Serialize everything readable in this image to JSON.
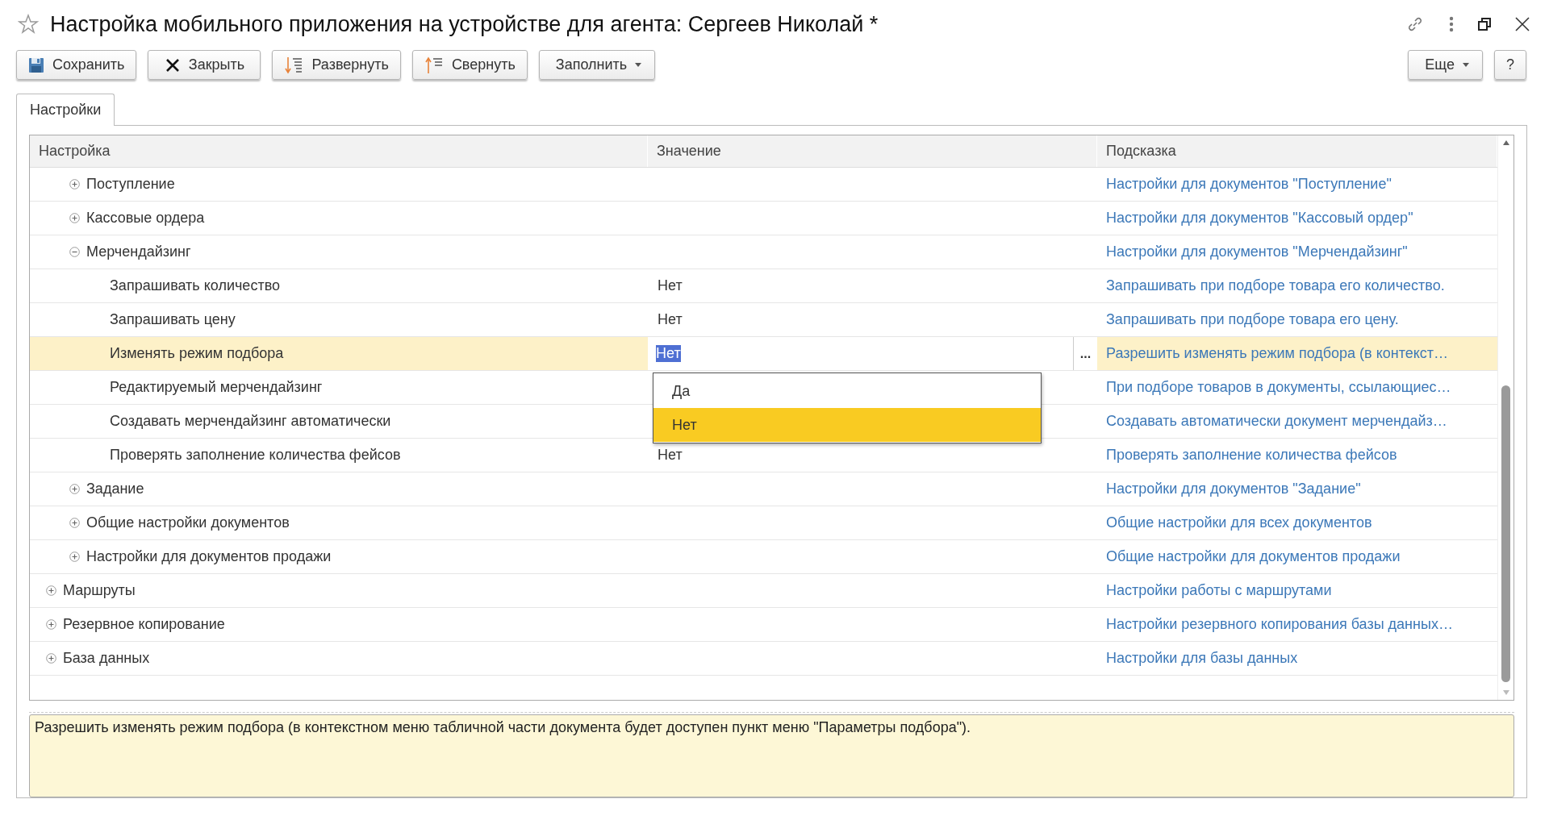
{
  "window": {
    "title": "Настройка мобильного приложения на устройстве для агента: Сергеев Николай *",
    "favorite": false
  },
  "toolbar": {
    "left": [
      {
        "label": "Сохранить",
        "kind": "save"
      },
      {
        "label": "Закрыть",
        "kind": "close"
      },
      {
        "label": "Развернуть",
        "kind": "expand"
      },
      {
        "label": "Свернуть",
        "kind": "collapse"
      },
      {
        "label": "Заполнить",
        "kind": "menu"
      }
    ],
    "right": [
      {
        "label": "Еще",
        "kind": "menu"
      },
      {
        "label": "?",
        "kind": "plain"
      }
    ]
  },
  "tabs": [
    {
      "label": "Настройки",
      "selected": true
    }
  ],
  "tree": {
    "columns": [
      "Настройка",
      "Значение",
      "Подсказка"
    ],
    "rows": [
      {
        "kind": "hidden_parent",
        "children": [
          {
            "kind": "group",
            "label": "Поступление",
            "expanded": false,
            "selected": false,
            "hint": "Настройки для документов \"Поступление\""
          },
          {
            "kind": "group",
            "label": "Кассовые ордера",
            "expanded": false,
            "selected": false,
            "hint": "Настройки для документов \"Кассовый ордер\""
          },
          {
            "kind": "group",
            "label": "Мерчендайзинг",
            "expanded": true,
            "selected": false,
            "hint": "Настройки для документов \"Мерчендайзинг\"",
            "children": [
              {
                "kind": "setting",
                "label": "Запрашивать количество",
                "value": "Нет",
                "selected": false,
                "hint": "Запрашивать при подборе товара его количество."
              },
              {
                "kind": "setting",
                "label": "Запрашивать цену",
                "value": "Нет",
                "selected": false,
                "hint": "Запрашивать при подборе товара его цену."
              },
              {
                "kind": "setting",
                "label": "Изменять режим подбора",
                "value": "Нет",
                "selected": true,
                "hint": "Разрешить изменять режим подбора (в контекст…",
                "editor_button": "...",
                "dropdown": [
                  {
                    "label": "Да",
                    "selected": false
                  },
                  {
                    "label": "Нет",
                    "selected": true
                  }
                ]
              },
              {
                "kind": "setting",
                "label": "Редактируемый мерчендайзинг",
                "selected": false,
                "hint": "При подборе товаров в документы, ссылающиес…"
              },
              {
                "kind": "setting",
                "label": "Создавать мерчендайзинг автоматически",
                "selected": false,
                "hint": "Создавать автоматически документ мерчендайз…"
              },
              {
                "kind": "setting",
                "label": "Проверять заполнение количества фейсов",
                "value": "Нет",
                "selected": false,
                "hint": "Проверять заполнение количества фейсов"
              }
            ]
          },
          {
            "kind": "group",
            "label": "Задание",
            "expanded": false,
            "selected": false,
            "hint": "Настройки для документов \"Задание\""
          },
          {
            "kind": "group",
            "label": "Общие настройки документов",
            "expanded": false,
            "selected": false,
            "hint": "Общие настройки для всех документов"
          },
          {
            "kind": "group",
            "label": "Настройки для документов продажи",
            "expanded": false,
            "selected": false,
            "hint": "Общие настройки для документов продажи"
          }
        ]
      },
      {
        "kind": "group",
        "label": "Маршруты",
        "expanded": false,
        "selected": false,
        "hint": "Настройки работы с маршрутами"
      },
      {
        "kind": "group",
        "label": "Резервное копирование",
        "expanded": false,
        "selected": false,
        "hint": "Настройки резервного копирования базы данных…"
      },
      {
        "kind": "group",
        "label": "База данных",
        "expanded": false,
        "selected": false,
        "hint": "Настройки для базы данных"
      }
    ]
  },
  "hint_panel": {
    "text": "Разрешить изменять режим подбора (в контекстном меню табличной части документа будет доступен пункт меню \"Параметры подбора\")."
  }
}
